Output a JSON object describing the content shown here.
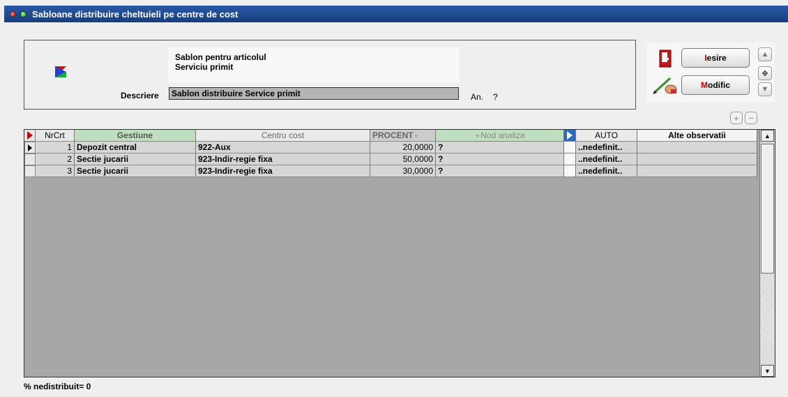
{
  "window": {
    "title": "Sabloane distribuire cheltuieli pe centre de cost"
  },
  "header": {
    "template_line1": "Sablon pentru articolul",
    "template_line2": "Serviciu primit",
    "description_label": "Descriere",
    "description_value": "Sablon distribuire Service primit",
    "year_label": "An.",
    "year_value": "?"
  },
  "buttons": {
    "exit_accel": "I",
    "exit_rest": "esire",
    "modify_accel": "M",
    "modify_rest": "odific"
  },
  "grid": {
    "columns": {
      "nr": "NrCrt",
      "gestiune": "Gestiune",
      "centru": "Centru cost",
      "procent": "PROCENT",
      "nod": "Nod analiza",
      "auto": "AUTO",
      "alte": "Alte observatii"
    },
    "rows": [
      {
        "nr": "1",
        "gestiune": "Depozit central",
        "centru": "922-Aux",
        "procent": "20,0000",
        "nod": "?",
        "auto": "..nedefinit..",
        "alte": ""
      },
      {
        "nr": "2",
        "gestiune": "Sectie jucarii",
        "centru": "923-Indir-regie fixa",
        "procent": "50,0000",
        "nod": "?",
        "auto": "..nedefinit..",
        "alte": ""
      },
      {
        "nr": "3",
        "gestiune": "Sectie jucarii",
        "centru": "923-Indir-regie fixa",
        "procent": "30,0000",
        "nod": "?",
        "auto": "..nedefinit..",
        "alte": ""
      }
    ]
  },
  "footer": {
    "undistributed": "% nedistribuit=  0"
  },
  "colors": {
    "titlebar": "#173d7d",
    "accent_red": "#c00000",
    "header_green": "#bfe0bf",
    "grid_bg": "#a7a7a7"
  },
  "icons": [
    "close-dot-icon",
    "minimize-dot-icon",
    "logo-icon",
    "door-exit-icon",
    "pencil-icon",
    "arrow-up-icon",
    "move-icon",
    "arrow-down-icon",
    "plus-icon",
    "minus-icon"
  ]
}
